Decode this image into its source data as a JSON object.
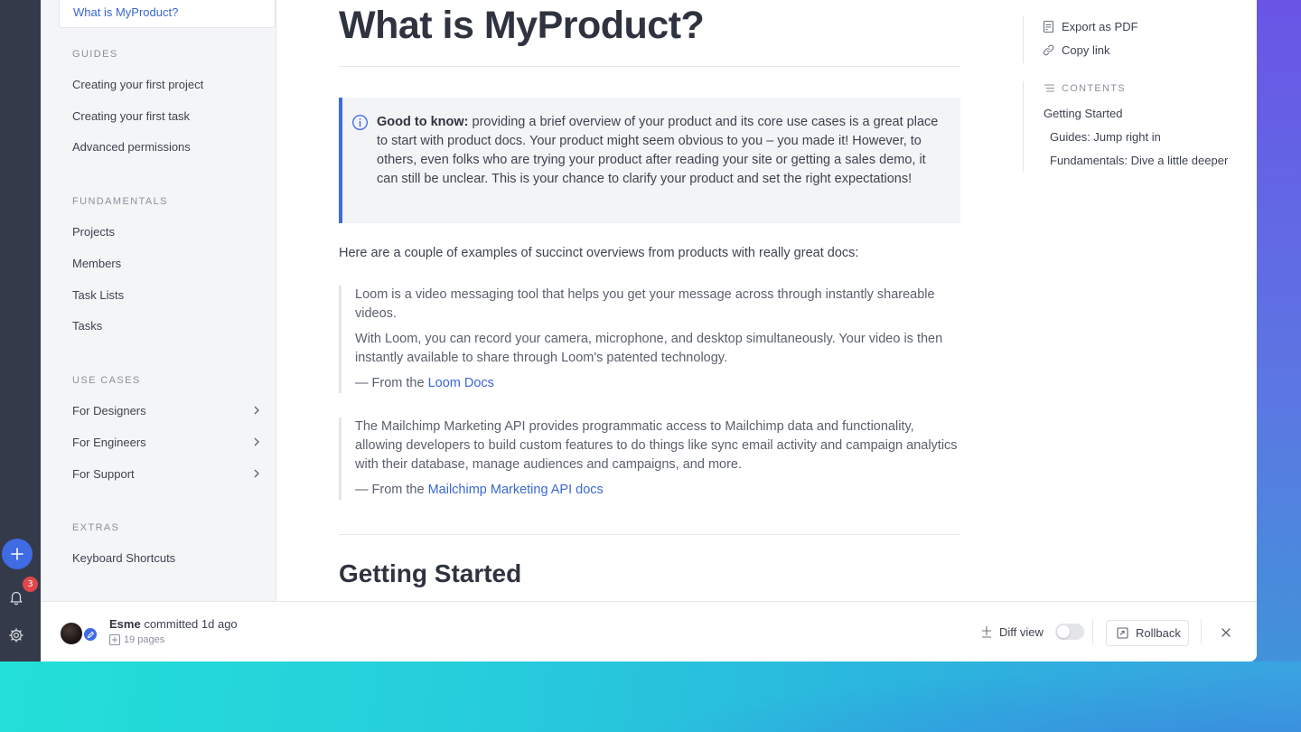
{
  "sidebar": {
    "active_item": "What is MyProduct?",
    "sections": [
      {
        "title": "GUIDES",
        "items": [
          "Creating your first project",
          "Creating your first task",
          "Advanced permissions"
        ]
      },
      {
        "title": "FUNDAMENTALS",
        "items": [
          "Projects",
          "Members",
          "Task Lists",
          "Tasks"
        ]
      },
      {
        "title": "USE CASES",
        "items": [
          "For Designers",
          "For Engineers",
          "For Support"
        ]
      },
      {
        "title": "EXTRAS",
        "items": [
          "Keyboard Shortcuts"
        ]
      }
    ]
  },
  "rail": {
    "notification_count": "3"
  },
  "main": {
    "title": "What is MyProduct?",
    "callout": {
      "label": "Good to know:",
      "text": " providing a brief overview of your product and its core use cases is a great place to start with product docs. Your product might seem obvious to you – you made it! However, to others, even folks who are trying your product after reading your site or getting a sales demo, it can still be unclear. This is your chance to clarify your product and set the right expectations!"
    },
    "intro": "Here are a couple of examples of succinct overviews from products with really great docs:",
    "quotes": [
      {
        "paragraphs": [
          "Loom is a video messaging tool that helps you get your message across through instantly shareable videos.",
          "With Loom, you can record your camera, microphone, and desktop simultaneously. Your video is then instantly available to share through Loom's patented technology."
        ],
        "source_prefix": "— From the ",
        "source_link": "Loom Docs"
      },
      {
        "paragraphs": [
          "The Mailchimp Marketing API provides programmatic access to Mailchimp data and functionality, allowing developers to build custom features to do things like sync email activity and campaign analytics with their database, manage audiences and campaigns, and more."
        ],
        "source_prefix": "— From the ",
        "source_link": "Mailchimp Marketing API docs"
      }
    ],
    "section_heading": "Getting Started"
  },
  "toc": {
    "export_label": "Export as PDF",
    "copy_label": "Copy link",
    "heading": "CONTENTS",
    "items": [
      "Getting Started",
      "Guides: Jump right in",
      "Fundamentals: Dive a little deeper"
    ]
  },
  "footer": {
    "author": "Esme",
    "commit_text": " committed 1d ago",
    "pages": "19 pages",
    "diff_label": "Diff view",
    "rollback_label": "Rollback"
  },
  "colors": {
    "accent": "#3f6be3",
    "link": "#3a67d6",
    "badge": "#e0464a",
    "rail": "#343a4a"
  }
}
